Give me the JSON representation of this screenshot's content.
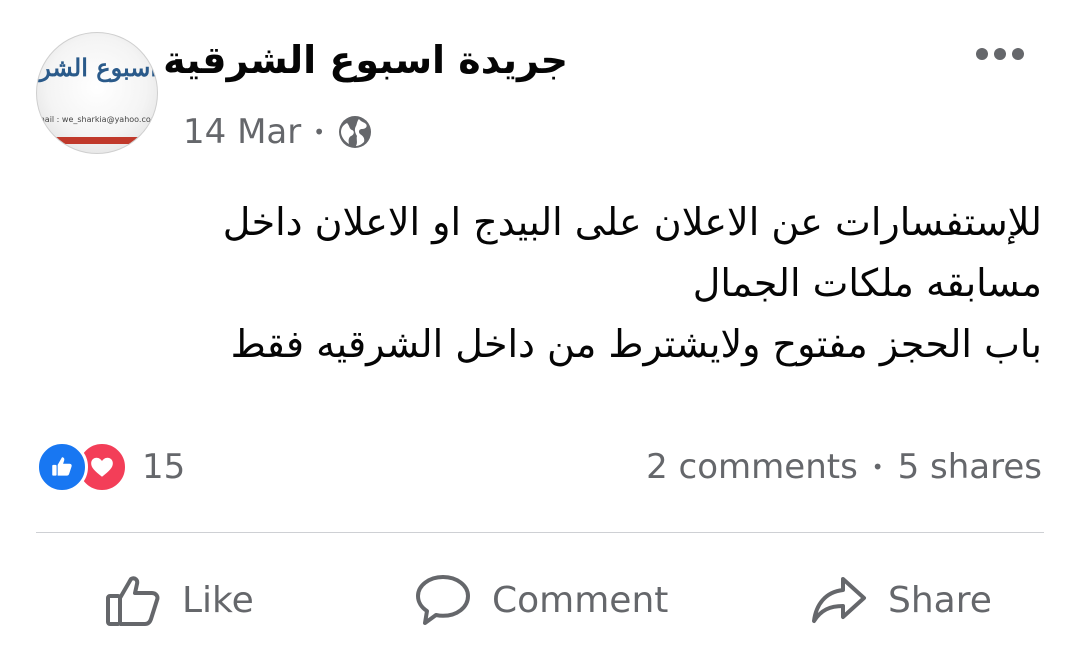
{
  "post": {
    "page_name": "جريدة اسبوع الشرقية",
    "date": "14 Mar",
    "separator": "•",
    "privacy_icon": "globe-icon",
    "avatar": {
      "logo_text": "اسبوع الشرقية",
      "email_line": "mail : we_sharkia@yahoo.com"
    },
    "text_lines": [
      "للإستفسارات عن الاعلان على البيدج او الاعلان  داخل",
      "مسابقه ملكات الجمال",
      "باب الحجز مفتوح  ولايشترط من داخل الشرقيه فقط"
    ]
  },
  "reactions": {
    "icons": [
      "like-reaction-icon",
      "love-reaction-icon"
    ],
    "count": "15"
  },
  "stats": {
    "comments": "2 comments",
    "separator": "•",
    "shares": "5 shares"
  },
  "actions": {
    "like": "Like",
    "comment": "Comment",
    "share": "Share"
  },
  "colors": {
    "accent": "#1877f2",
    "love": "#f33e58",
    "secondary_text": "#65676b",
    "divider": "#ced0d4"
  }
}
